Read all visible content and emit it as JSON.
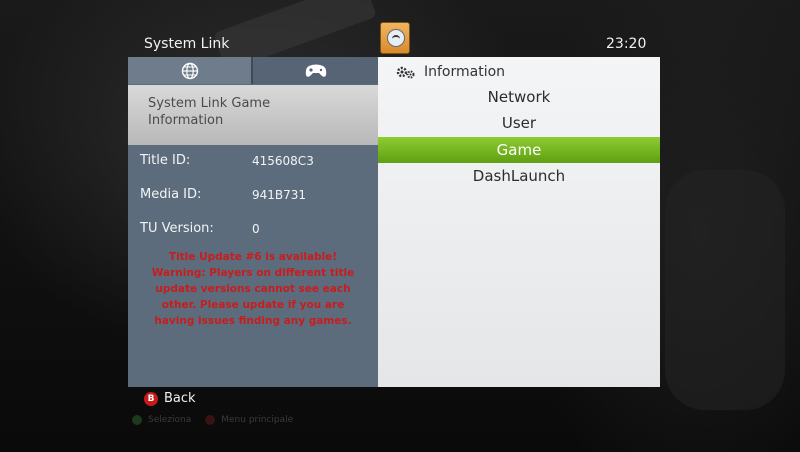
{
  "header": {
    "title": "System Link",
    "time": "23:20"
  },
  "left_panel": {
    "tabs": [
      {
        "icon": "globe-icon"
      },
      {
        "icon": "controller-icon"
      }
    ],
    "section_title": "System Link Game Information",
    "fields": [
      {
        "label": "Title ID:",
        "value": "415608C3"
      },
      {
        "label": "Media ID:",
        "value": "941B731"
      },
      {
        "label": "TU Version:",
        "value": "0"
      }
    ],
    "warning": "Title Update #6 is available! Warning: Players on different title update versions cannot see each other. Please update if you are having issues finding any games."
  },
  "right_panel": {
    "header": "Information",
    "menu": [
      "Network",
      "User",
      "Game",
      "DashLaunch"
    ],
    "selected": "Game"
  },
  "footer": {
    "back_button": "B",
    "back_label": "Back",
    "ghost_a_label": "Seleziona",
    "ghost_b_label": "Menu principale"
  },
  "colors": {
    "selected_item": "#6fb01f",
    "warning_text": "#c61d1d",
    "left_panel": "#5c6c7d",
    "b_button": "#c71a1a"
  }
}
